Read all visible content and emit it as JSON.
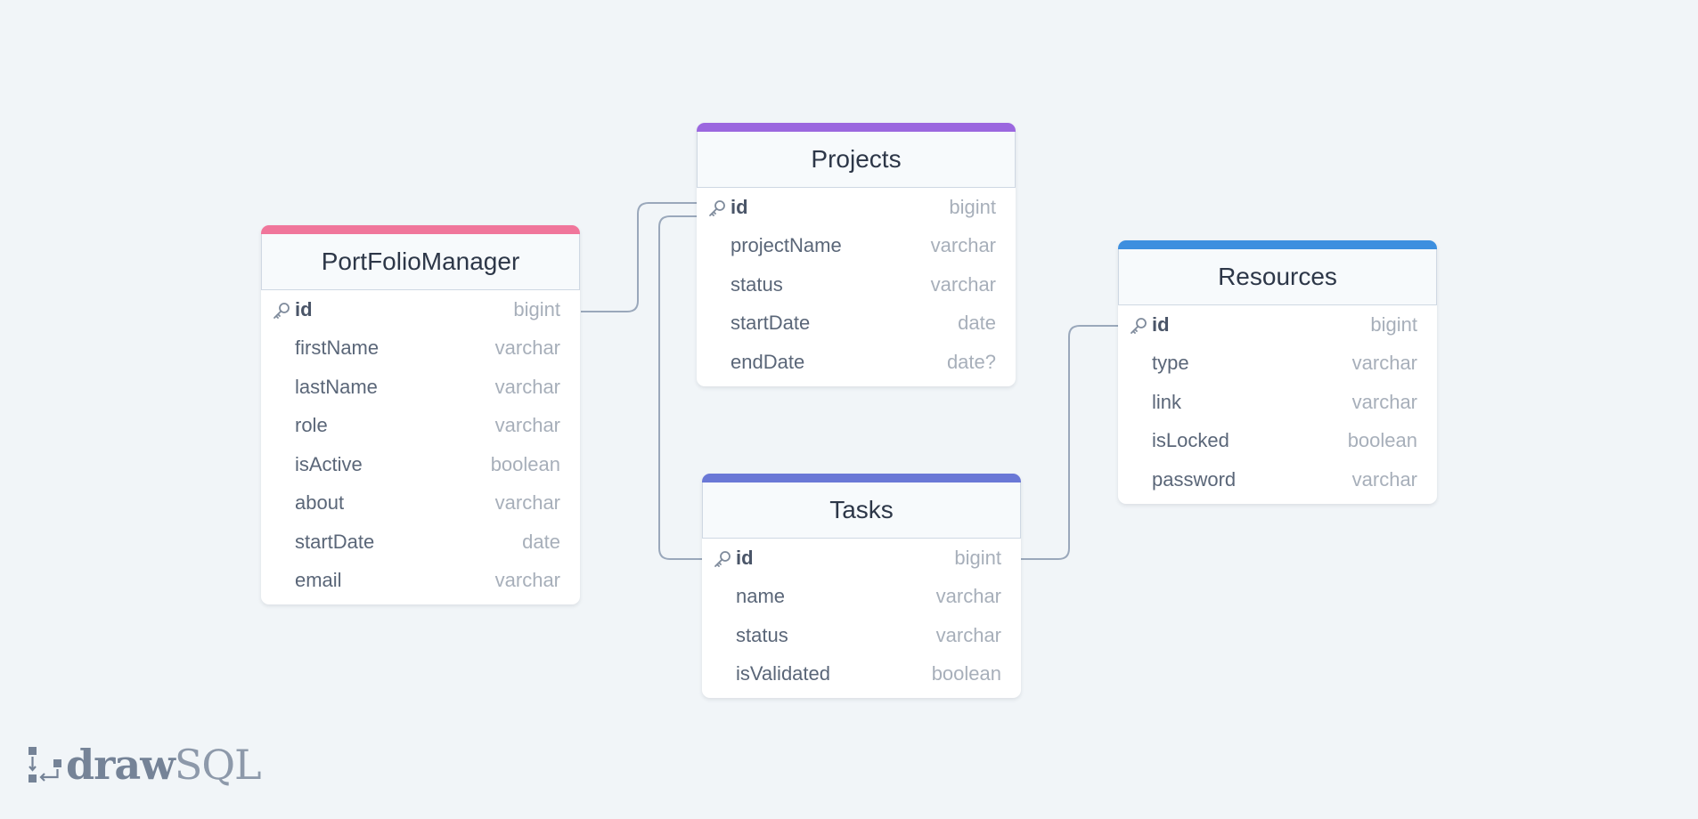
{
  "tables": [
    {
      "name": "PortFolioManager",
      "color": "#f0769b",
      "columns": [
        {
          "name": "id",
          "type": "bigint",
          "pk": true
        },
        {
          "name": "firstName",
          "type": "varchar"
        },
        {
          "name": "lastName",
          "type": "varchar"
        },
        {
          "name": "role",
          "type": "varchar"
        },
        {
          "name": "isActive",
          "type": "boolean"
        },
        {
          "name": "about",
          "type": "varchar"
        },
        {
          "name": "startDate",
          "type": "date"
        },
        {
          "name": "email",
          "type": "varchar"
        }
      ]
    },
    {
      "name": "Projects",
      "color": "#9b67df",
      "columns": [
        {
          "name": "id",
          "type": "bigint",
          "pk": true
        },
        {
          "name": "projectName",
          "type": "varchar"
        },
        {
          "name": "status",
          "type": "varchar"
        },
        {
          "name": "startDate",
          "type": "date"
        },
        {
          "name": "endDate",
          "type": "date?"
        }
      ]
    },
    {
      "name": "Tasks",
      "color": "#6a78d6",
      "columns": [
        {
          "name": "id",
          "type": "bigint",
          "pk": true
        },
        {
          "name": "name",
          "type": "varchar"
        },
        {
          "name": "status",
          "type": "varchar"
        },
        {
          "name": "isValidated",
          "type": "boolean"
        }
      ]
    },
    {
      "name": "Resources",
      "color": "#3d8fdf",
      "columns": [
        {
          "name": "id",
          "type": "bigint",
          "pk": true
        },
        {
          "name": "type",
          "type": "varchar"
        },
        {
          "name": "link",
          "type": "varchar"
        },
        {
          "name": "isLocked",
          "type": "boolean"
        },
        {
          "name": "password",
          "type": "varchar"
        }
      ]
    }
  ],
  "relationships": [
    {
      "from": "PortFolioManager.id",
      "to": "Projects.id"
    },
    {
      "from": "Projects.id",
      "to": "Tasks.id"
    },
    {
      "from": "Tasks.id",
      "to": "Resources.id"
    }
  ],
  "logo": {
    "bold": "draw",
    "light": "SQL"
  }
}
